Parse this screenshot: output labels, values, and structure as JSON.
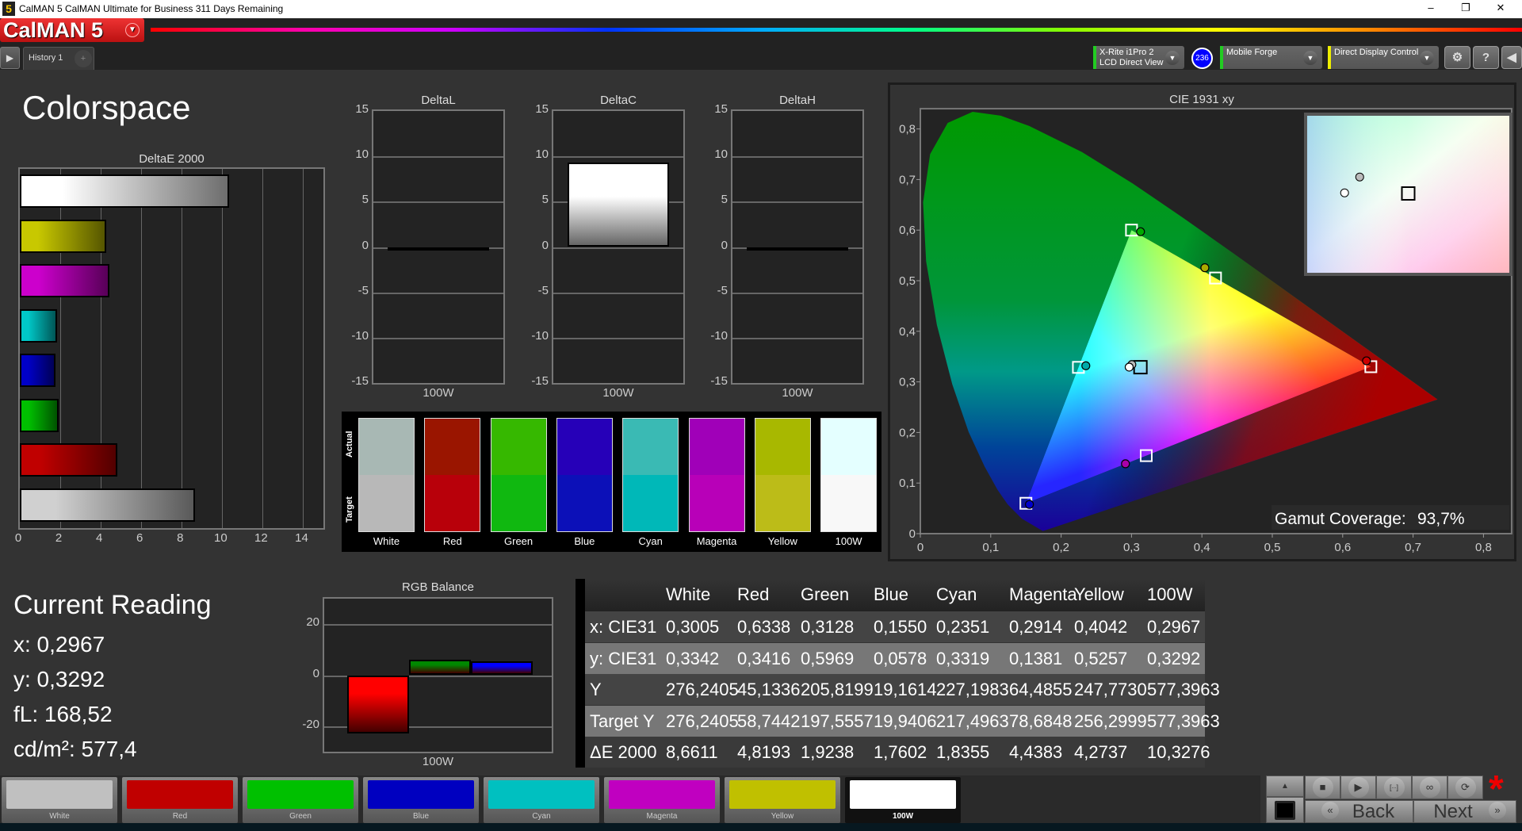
{
  "window": {
    "title": "CalMAN 5 CalMAN Ultimate for Business 311 Days Remaining",
    "app_icon": "5",
    "minimize": "–",
    "restore": "❐",
    "close": "✕"
  },
  "app": {
    "logo": "CalMAN 5",
    "history_tab": "History 1",
    "add_tab": "+"
  },
  "toolbar": {
    "meter_line1": "X-Rite i1Pro 2",
    "meter_line2": "LCD Direct View",
    "meter_badge": "236",
    "source": "Mobile Forge",
    "display": "Direct Display Control",
    "meter_color": "#22cc22",
    "source_color": "#22cc22",
    "display_color": "#eeee00"
  },
  "page": {
    "title": "Colorspace"
  },
  "current_reading": {
    "title": "Current Reading",
    "x": "x: 0,2967",
    "y": "y: 0,3292",
    "fl": "fL: 168,52",
    "cd": "cd/m²: 577,4"
  },
  "swatch_panel": {
    "actual_label": "Actual",
    "target_label": "Target",
    "items": [
      {
        "label": "White",
        "actual": "#a8b8b4",
        "target": "#b8b8b8"
      },
      {
        "label": "Red",
        "actual": "#9a1500",
        "target": "#b8000a"
      },
      {
        "label": "Green",
        "actual": "#36b800",
        "target": "#10b810"
      },
      {
        "label": "Blue",
        "actual": "#2600b8",
        "target": "#0c10b8"
      },
      {
        "label": "Cyan",
        "actual": "#3abab4",
        "target": "#00b8b8"
      },
      {
        "label": "Magenta",
        "actual": "#a000b8",
        "target": "#b800b8"
      },
      {
        "label": "Yellow",
        "actual": "#a8b800",
        "target": "#bcbc18"
      },
      {
        "label": "100W",
        "actual": "#e4ffff",
        "target": "#f8f8f8"
      }
    ]
  },
  "table": {
    "columns": [
      "",
      "White",
      "Red",
      "Green",
      "Blue",
      "Cyan",
      "Magenta",
      "Yellow",
      "100W"
    ],
    "rows": [
      [
        "x: CIE31",
        "0,3005",
        "0,6338",
        "0,3128",
        "0,1550",
        "0,2351",
        "0,2914",
        "0,4042",
        "0,2967"
      ],
      [
        "y: CIE31",
        "0,3342",
        "0,3416",
        "0,5969",
        "0,0578",
        "0,3319",
        "0,1381",
        "0,5257",
        "0,3292"
      ],
      [
        "Y",
        "276,2405",
        "45,1336",
        "205,8199",
        "19,1614",
        "227,1983",
        "64,4855",
        "247,7730",
        "577,3963"
      ],
      [
        "Target Y",
        "276,2405",
        "58,7442",
        "197,5557",
        "19,9406",
        "217,4963",
        "78,6848",
        "256,2999",
        "577,3963"
      ],
      [
        "ΔE 2000",
        "8,6611",
        "4,8193",
        "1,9238",
        "1,7602",
        "1,8355",
        "4,4383",
        "4,2737",
        "10,3276"
      ]
    ]
  },
  "bottom_swatches": [
    {
      "label": "White",
      "color": "#c0c0c0"
    },
    {
      "label": "Red",
      "color": "#c00000"
    },
    {
      "label": "Green",
      "color": "#00c000"
    },
    {
      "label": "Blue",
      "color": "#0000c0"
    },
    {
      "label": "Cyan",
      "color": "#00c0c0"
    },
    {
      "label": "Magenta",
      "color": "#c000c0"
    },
    {
      "label": "Yellow",
      "color": "#c0c000"
    },
    {
      "label": "100W",
      "color": "#ffffff",
      "selected": true
    }
  ],
  "controls": {
    "back": "Back",
    "next": "Next",
    "back_icon": "«",
    "next_icon": "»",
    "stop": "■",
    "play": "▶",
    "step": "[··]",
    "loop": "∞",
    "refresh": "⟳",
    "up": "▲",
    "asterisk": "*"
  },
  "chart_data": [
    {
      "id": "deltae",
      "type": "bar",
      "orientation": "horizontal",
      "title": "DeltaE 2000",
      "xlim": [
        0,
        15
      ],
      "ticks": [
        0,
        2,
        4,
        6,
        8,
        10,
        12,
        14
      ],
      "categories": [
        "100W",
        "Yellow",
        "Magenta",
        "Cyan",
        "Blue",
        "Green",
        "Red",
        "White"
      ],
      "values": [
        10.3276,
        4.2737,
        4.4383,
        1.8355,
        1.7602,
        1.9238,
        4.8193,
        8.6611
      ],
      "colors": [
        "#ffffff",
        "#c8c800",
        "#cc00cc",
        "#00c8c8",
        "#0000c8",
        "#00c000",
        "#c00000",
        "#d0d0d0"
      ]
    },
    {
      "id": "deltal",
      "type": "bar",
      "title": "DeltaL",
      "ylim": [
        -15,
        15
      ],
      "ticks": [
        15,
        10,
        5,
        0,
        -5,
        -10,
        -15
      ],
      "categories": [
        "100W"
      ],
      "values": [
        0
      ]
    },
    {
      "id": "deltac",
      "type": "bar",
      "title": "DeltaC",
      "ylim": [
        -15,
        15
      ],
      "ticks": [
        15,
        10,
        5,
        0,
        -5,
        -10,
        -15
      ],
      "categories": [
        "100W"
      ],
      "values": [
        9.3
      ]
    },
    {
      "id": "deltah",
      "type": "bar",
      "title": "DeltaH",
      "ylim": [
        -15,
        15
      ],
      "ticks": [
        15,
        10,
        5,
        0,
        -5,
        -10,
        -15
      ],
      "categories": [
        "100W"
      ],
      "values": [
        0
      ]
    },
    {
      "id": "rgb",
      "type": "bar",
      "title": "RGB Balance",
      "ylim": [
        -30,
        30
      ],
      "ticks": [
        20,
        0,
        -20
      ],
      "categories": [
        "100W"
      ],
      "series": [
        {
          "values": [
            -23
          ],
          "color": "#ff0000"
        },
        {
          "values": [
            6
          ],
          "color": "#008800"
        },
        {
          "values": [
            5.5
          ],
          "color": "#0000ff"
        }
      ]
    },
    {
      "id": "cie",
      "type": "scatter",
      "title": "CIE 1931 xy",
      "xlim": [
        0,
        0.84
      ],
      "ylim": [
        0,
        0.84
      ],
      "xticks": [
        "0",
        "0,1",
        "0,2",
        "0,3",
        "0,4",
        "0,5",
        "0,6",
        "0,7",
        "0,8"
      ],
      "yticks": [
        "0",
        "0,1",
        "0,2",
        "0,3",
        "0,4",
        "0,5",
        "0,6",
        "0,7",
        "0,8"
      ],
      "gamut_coverage_label": "Gamut Coverage:",
      "gamut_coverage": "93,7%",
      "targets": [
        {
          "name": "Red",
          "x": 0.64,
          "y": 0.33
        },
        {
          "name": "Green",
          "x": 0.3,
          "y": 0.6
        },
        {
          "name": "Blue",
          "x": 0.15,
          "y": 0.06
        },
        {
          "name": "White",
          "x": 0.3127,
          "y": 0.329
        },
        {
          "name": "Cyan",
          "x": 0.2246,
          "y": 0.3287
        },
        {
          "name": "Magenta",
          "x": 0.3209,
          "y": 0.1542
        },
        {
          "name": "Yellow",
          "x": 0.4193,
          "y": 0.5053
        }
      ],
      "measured": [
        {
          "name": "White",
          "x": 0.3005,
          "y": 0.3342,
          "color": "#bbbbbb"
        },
        {
          "name": "Red",
          "x": 0.6338,
          "y": 0.3416,
          "color": "#cc0000"
        },
        {
          "name": "Green",
          "x": 0.3128,
          "y": 0.5969,
          "color": "#00aa00"
        },
        {
          "name": "Blue",
          "x": 0.155,
          "y": 0.0578,
          "color": "#0000cc"
        },
        {
          "name": "Cyan",
          "x": 0.2351,
          "y": 0.3319,
          "color": "#00aaaa"
        },
        {
          "name": "Magenta",
          "x": 0.2914,
          "y": 0.1381,
          "color": "#aa00aa"
        },
        {
          "name": "Yellow",
          "x": 0.4042,
          "y": 0.5257,
          "color": "#aaaa00"
        },
        {
          "name": "100W",
          "x": 0.2967,
          "y": 0.3292,
          "color": "#ffffff"
        }
      ],
      "inset_xlim": [
        0.2873,
        0.3381
      ],
      "inset_ylim": [
        0.304,
        0.3535
      ]
    }
  ]
}
